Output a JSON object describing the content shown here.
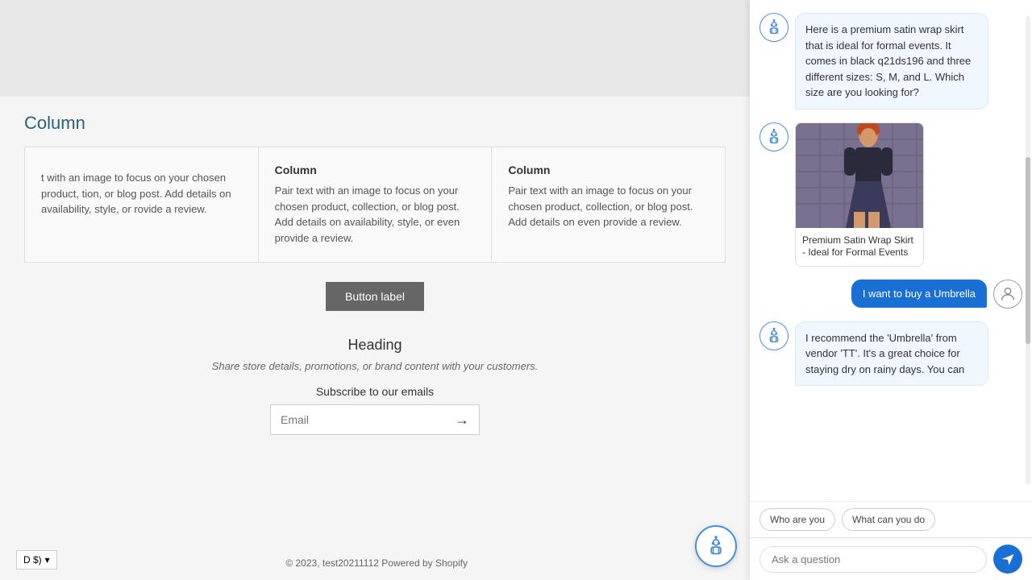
{
  "page": {
    "heading": "Column",
    "columns": [
      {
        "title": "",
        "text": "t with an image to focus on your chosen product, tion, or blog post. Add details on availability, style, or rovide a review."
      },
      {
        "title": "Column",
        "text": "Pair text with an image to focus on your chosen product, collection, or blog post. Add details on availability, style, or even provide a review."
      },
      {
        "title": "Column",
        "text": "Pair text with an image to focus on your chosen product, collection, or blog post. Add details on even provide a review."
      }
    ],
    "button_label": "Button label",
    "section_heading": "Heading",
    "section_sub": "Share store details, promotions, or brand content with your customers.",
    "email_section_label": "Subscribe to our emails",
    "email_placeholder": "Email",
    "footer_currency": "D $)",
    "footer_copyright": "© 2023, test20211112 Powered by Shopify"
  },
  "chat": {
    "messages": [
      {
        "type": "bot",
        "text": "Here is a premium satin wrap skirt that is ideal for formal events. It comes in black q21ds196 and three different sizes: S, M, and L. Which size are you looking for?"
      },
      {
        "type": "bot",
        "has_product": true,
        "product_title": "Premium Satin Wrap Skirt - Ideal for Formal Events"
      },
      {
        "type": "user",
        "text": "I want to buy a Umbrella"
      },
      {
        "type": "bot",
        "text": "I recommend the 'Umbrella' from vendor 'TT'. It's a great choice for staying dry on rainy days. You can"
      }
    ],
    "suggestions": [
      "Who are you",
      "What can you do"
    ],
    "input_placeholder": "Ask a question"
  }
}
